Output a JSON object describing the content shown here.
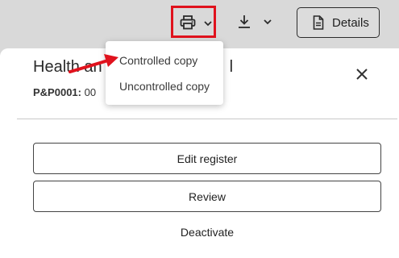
{
  "toolbar": {
    "print_icon": "printer-icon",
    "download_icon": "download-icon",
    "chevron_icon": "chevron-down-icon",
    "details_icon": "document-icon",
    "details_label": "Details",
    "highlight_color": "#e0121d"
  },
  "print_menu": {
    "items": [
      {
        "label": "Controlled copy"
      },
      {
        "label": "Uncontrolled copy"
      }
    ]
  },
  "panel": {
    "title": "Health an",
    "title_tail": "l",
    "code_label": "P&P0001:",
    "code_value": "00",
    "close_icon": "close-icon"
  },
  "actions": {
    "edit_label": "Edit register",
    "review_label": "Review",
    "deactivate_label": "Deactivate"
  },
  "annotation": {
    "arrow_color": "#e0121d"
  }
}
